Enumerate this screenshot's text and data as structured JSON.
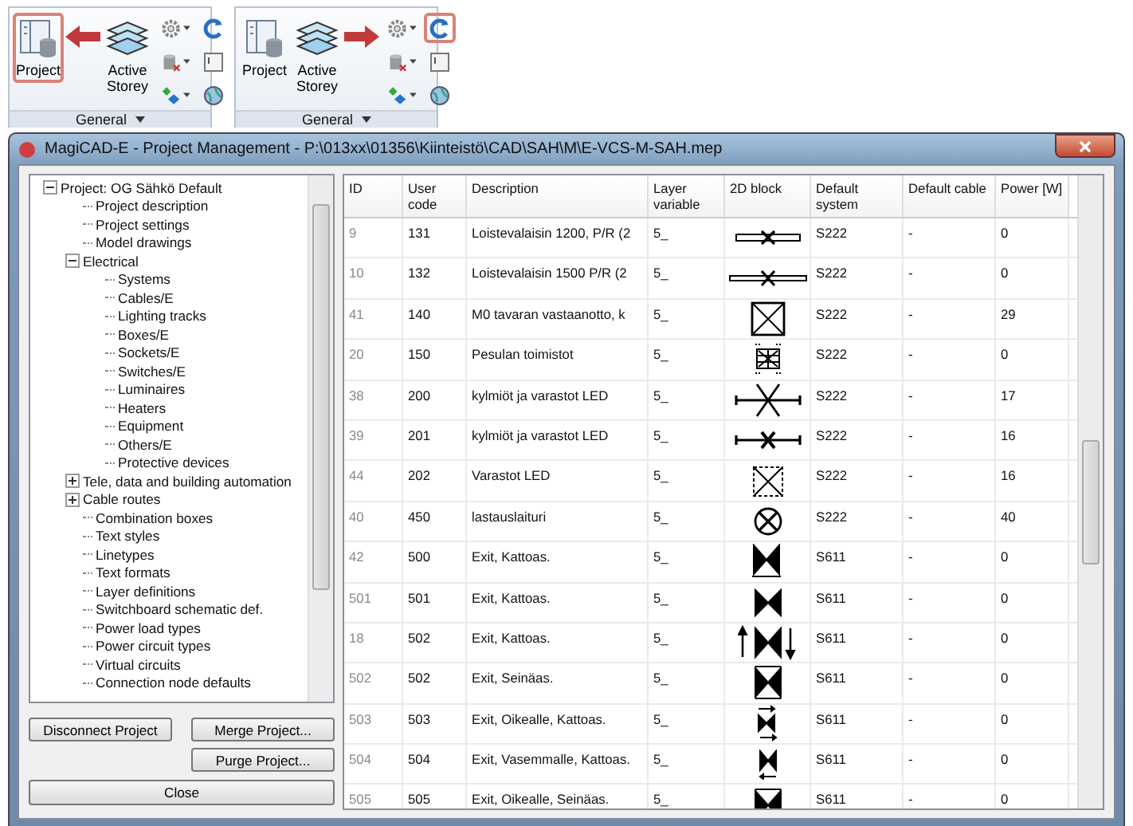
{
  "ribbon_panels": [
    {
      "kind": "arrow-left",
      "large_buttons": [
        {
          "label": "Project",
          "kind": "project",
          "highlighted": true
        },
        {
          "label": "Active Storey",
          "kind": "storey",
          "highlighted": false
        }
      ],
      "small_buttons": [
        {
          "kind": "gear",
          "dropdown": true,
          "highlighted": false
        },
        {
          "kind": "refresh",
          "dropdown": false,
          "highlighted": false
        },
        {
          "kind": "database",
          "dropdown": true,
          "highlighted": false
        },
        {
          "kind": "window",
          "dropdown": false,
          "highlighted": false
        },
        {
          "kind": "diamonds",
          "dropdown": true,
          "highlighted": false
        },
        {
          "kind": "globe",
          "dropdown": false,
          "highlighted": false
        }
      ],
      "footer": "General"
    },
    {
      "kind": "arrow-right",
      "large_buttons": [
        {
          "label": "Project",
          "kind": "project",
          "highlighted": false
        },
        {
          "label": "Active Storey",
          "kind": "storey",
          "highlighted": false
        }
      ],
      "small_buttons": [
        {
          "kind": "gear",
          "dropdown": true,
          "highlighted": false
        },
        {
          "kind": "refresh",
          "dropdown": false,
          "highlighted": true
        },
        {
          "kind": "database",
          "dropdown": true,
          "highlighted": false
        },
        {
          "kind": "window",
          "dropdown": false,
          "highlighted": false
        },
        {
          "kind": "diamonds",
          "dropdown": true,
          "highlighted": false
        },
        {
          "kind": "globe",
          "dropdown": false,
          "highlighted": false
        }
      ],
      "footer": "General"
    }
  ],
  "window": {
    "title": "MagiCAD-E - Project Management - P:\\013xx\\01356\\Kiinteistö\\CAD\\SAH\\M\\E-VCS-M-SAH.mep"
  },
  "tree": [
    {
      "label": "Project: OG Sähkö Default",
      "expanded": true,
      "children": [
        {
          "label": "Project description"
        },
        {
          "label": "Project settings"
        },
        {
          "label": "Model drawings"
        },
        {
          "label": "Electrical",
          "expanded": true,
          "children": [
            {
              "label": "Systems"
            },
            {
              "label": "Cables/E"
            },
            {
              "label": "Lighting tracks"
            },
            {
              "label": "Boxes/E"
            },
            {
              "label": "Sockets/E"
            },
            {
              "label": "Switches/E"
            },
            {
              "label": "Luminaires"
            },
            {
              "label": "Heaters"
            },
            {
              "label": "Equipment"
            },
            {
              "label": "Others/E"
            },
            {
              "label": "Protective devices"
            }
          ]
        },
        {
          "label": "Tele, data and building automation",
          "expanded": false
        },
        {
          "label": "Cable routes",
          "expanded": false
        },
        {
          "label": "Combination boxes"
        },
        {
          "label": "Text styles"
        },
        {
          "label": "Linetypes"
        },
        {
          "label": "Text formats"
        },
        {
          "label": "Layer definitions"
        },
        {
          "label": "Switchboard schematic def."
        },
        {
          "label": "Power load types"
        },
        {
          "label": "Power circuit types"
        },
        {
          "label": "Virtual circuits"
        },
        {
          "label": "Connection node defaults"
        }
      ]
    }
  ],
  "buttons": {
    "disconnect": "Disconnect Project",
    "merge": "Merge Project...",
    "purge": "Purge Project...",
    "close": "Close"
  },
  "table": {
    "columns": [
      "ID",
      "User code",
      "Description",
      "Layer variable",
      "2D block",
      "Default system",
      "Default cable",
      "Power [W]"
    ],
    "rows": [
      {
        "id": "9",
        "user_code": "131",
        "description": "Loistevalaisin 1200, P/R (2",
        "layer": "5_",
        "kind": "bar-cross",
        "system": "S222",
        "cable": "-",
        "power": "0"
      },
      {
        "id": "10",
        "user_code": "132",
        "description": "Loistevalaisin 1500 P/R (2",
        "layer": "5_",
        "kind": "long-bar-cross",
        "system": "S222",
        "cable": "-",
        "power": "0"
      },
      {
        "id": "41",
        "user_code": "140",
        "description": "M0 tavaran vastaanotto, k",
        "layer": "5_",
        "kind": "box-cross",
        "system": "S222",
        "cable": "-",
        "power": "29"
      },
      {
        "id": "20",
        "user_code": "150",
        "description": "Pesulan toimistot",
        "layer": "5_",
        "kind": "grid-box",
        "system": "S222",
        "cable": "-",
        "power": "0"
      },
      {
        "id": "38",
        "user_code": "200",
        "description": "kylmiöt ja varastot LED",
        "layer": "5_",
        "kind": "line-cross",
        "system": "S222",
        "cable": "-",
        "power": "17"
      },
      {
        "id": "39",
        "user_code": "201",
        "description": "kylmiöt ja varastot LED",
        "layer": "5_",
        "kind": "line-small-cross",
        "system": "S222",
        "cable": "-",
        "power": "16"
      },
      {
        "id": "44",
        "user_code": "202",
        "description": "Varastot LED",
        "layer": "5_",
        "kind": "dashed-box-cross",
        "system": "S222",
        "cable": "-",
        "power": "16"
      },
      {
        "id": "40",
        "user_code": "450",
        "description": "lastauslaituri",
        "layer": "5_",
        "kind": "circle-cross",
        "system": "S222",
        "cable": "-",
        "power": "40"
      },
      {
        "id": "42",
        "user_code": "500",
        "description": "Exit, Kattoas.",
        "layer": "5_",
        "kind": "bowtie-base",
        "system": "S611",
        "cable": "-",
        "power": "0"
      },
      {
        "id": "501",
        "user_code": "501",
        "description": "Exit, Kattoas.",
        "layer": "5_",
        "kind": "bowtie",
        "system": "S611",
        "cable": "-",
        "power": "0"
      },
      {
        "id": "18",
        "user_code": "502",
        "description": "Exit, Kattoas.",
        "layer": "5_",
        "kind": "bowtie-arrows",
        "system": "S611",
        "cable": "-",
        "power": "0"
      },
      {
        "id": "502",
        "user_code": "502",
        "description": "Exit, Seinäas.",
        "layer": "5_",
        "kind": "bowtie-frame",
        "system": "S611",
        "cable": "-",
        "power": "0"
      },
      {
        "id": "503",
        "user_code": "503",
        "description": "Exit, Oikealle, Kattoas.",
        "layer": "5_",
        "kind": "bowtie-right",
        "system": "S611",
        "cable": "-",
        "power": "0"
      },
      {
        "id": "504",
        "user_code": "504",
        "description": "Exit, Vasemmalle, Kattoas.",
        "layer": "5_",
        "kind": "bowtie-left",
        "system": "S611",
        "cable": "-",
        "power": "0"
      },
      {
        "id": "505",
        "user_code": "505",
        "description": "Exit, Oikealle, Seinäas.",
        "layer": "5_",
        "kind": "bowtie-frame",
        "system": "S611",
        "cable": "-",
        "power": "0"
      }
    ]
  }
}
